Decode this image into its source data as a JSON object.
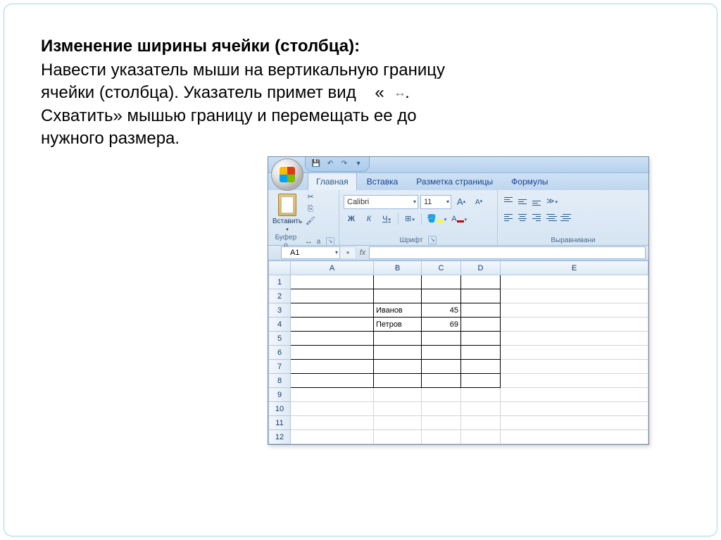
{
  "text": {
    "title": "Изменение ширины ячейки (столбца):",
    "line1": "Навести указатель мыши на вертикальную границу",
    "line2a": "ячейки (столбца). Указатель примет вид",
    "line2b": "«",
    "cursor": "↔",
    "line3": "Схватить» мышью границу и перемещать ее до",
    "line4": "нужного размера."
  },
  "excel": {
    "qat_dropdown": "▾",
    "tabs": {
      "home": "Главная",
      "insert": "Вставка",
      "layout": "Разметка страницы",
      "formulas": "Формулы"
    },
    "ribbon": {
      "paste": "Вставить",
      "clipboard_label_a": "Буфер о",
      "clipboard_label_b": "а",
      "clipboard_cursor": "↔",
      "font_label": "Шрифт",
      "align_label": "Выравнивани",
      "font_name": "Calibri",
      "font_size": "11",
      "bold": "Ж",
      "italic": "К",
      "underline": "Ч",
      "inc": "A",
      "dec": "A",
      "border": "⊞",
      "fill_a": "A",
      "font_a": "A"
    },
    "namebox": "A1",
    "fx": "fx",
    "columns": [
      "A",
      "B",
      "C",
      "D",
      "E"
    ],
    "rows": [
      "1",
      "2",
      "3",
      "4",
      "5",
      "6",
      "7",
      "8",
      "9",
      "10",
      "11",
      "12"
    ],
    "cells": {
      "b3": "Иванов",
      "c3": "45",
      "b4": "Петров",
      "c4": "69"
    }
  }
}
